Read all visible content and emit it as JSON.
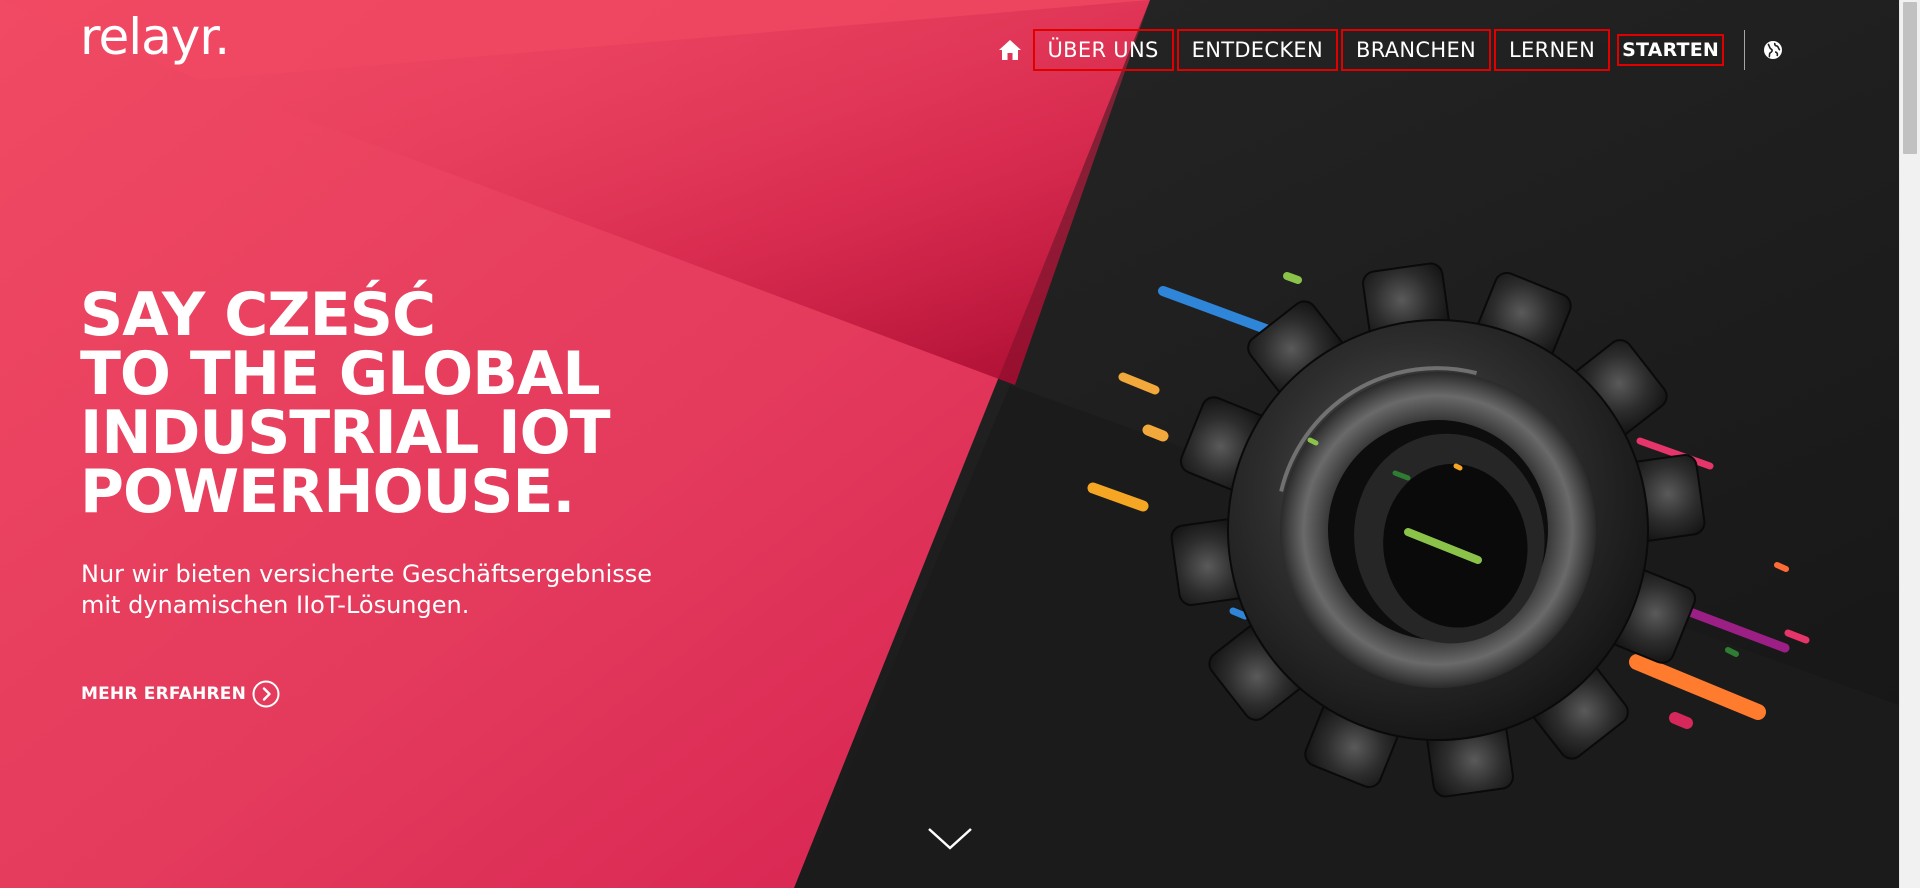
{
  "brand": {
    "logo_text": "relayr.",
    "accent_color": "#e8345a",
    "dark_color": "#1f1f1f"
  },
  "nav": {
    "home_icon": "home-icon",
    "items": [
      {
        "label": "ÜBER UNS"
      },
      {
        "label": "ENTDECKEN"
      },
      {
        "label": "BRANCHEN"
      },
      {
        "label": "LERNEN"
      }
    ],
    "cta_label": "STARTEN",
    "globe_icon": "globe-icon"
  },
  "hero": {
    "headline_lines": [
      "SAY CZEŚĆ",
      "TO THE GLOBAL",
      "INDUSTRIAL IOT",
      "POWERHOUSE."
    ],
    "subtitle_lines": [
      "Nur wir bieten versicherte Geschäftsergebnisse",
      "mit dynamischen IIoT-Lösungen."
    ],
    "cta_label": "MEHR ERFAHREN",
    "cta_icon": "chevron-right-circle-icon",
    "scroll_icon": "chevron-down-icon",
    "image": "gear-illustration"
  }
}
